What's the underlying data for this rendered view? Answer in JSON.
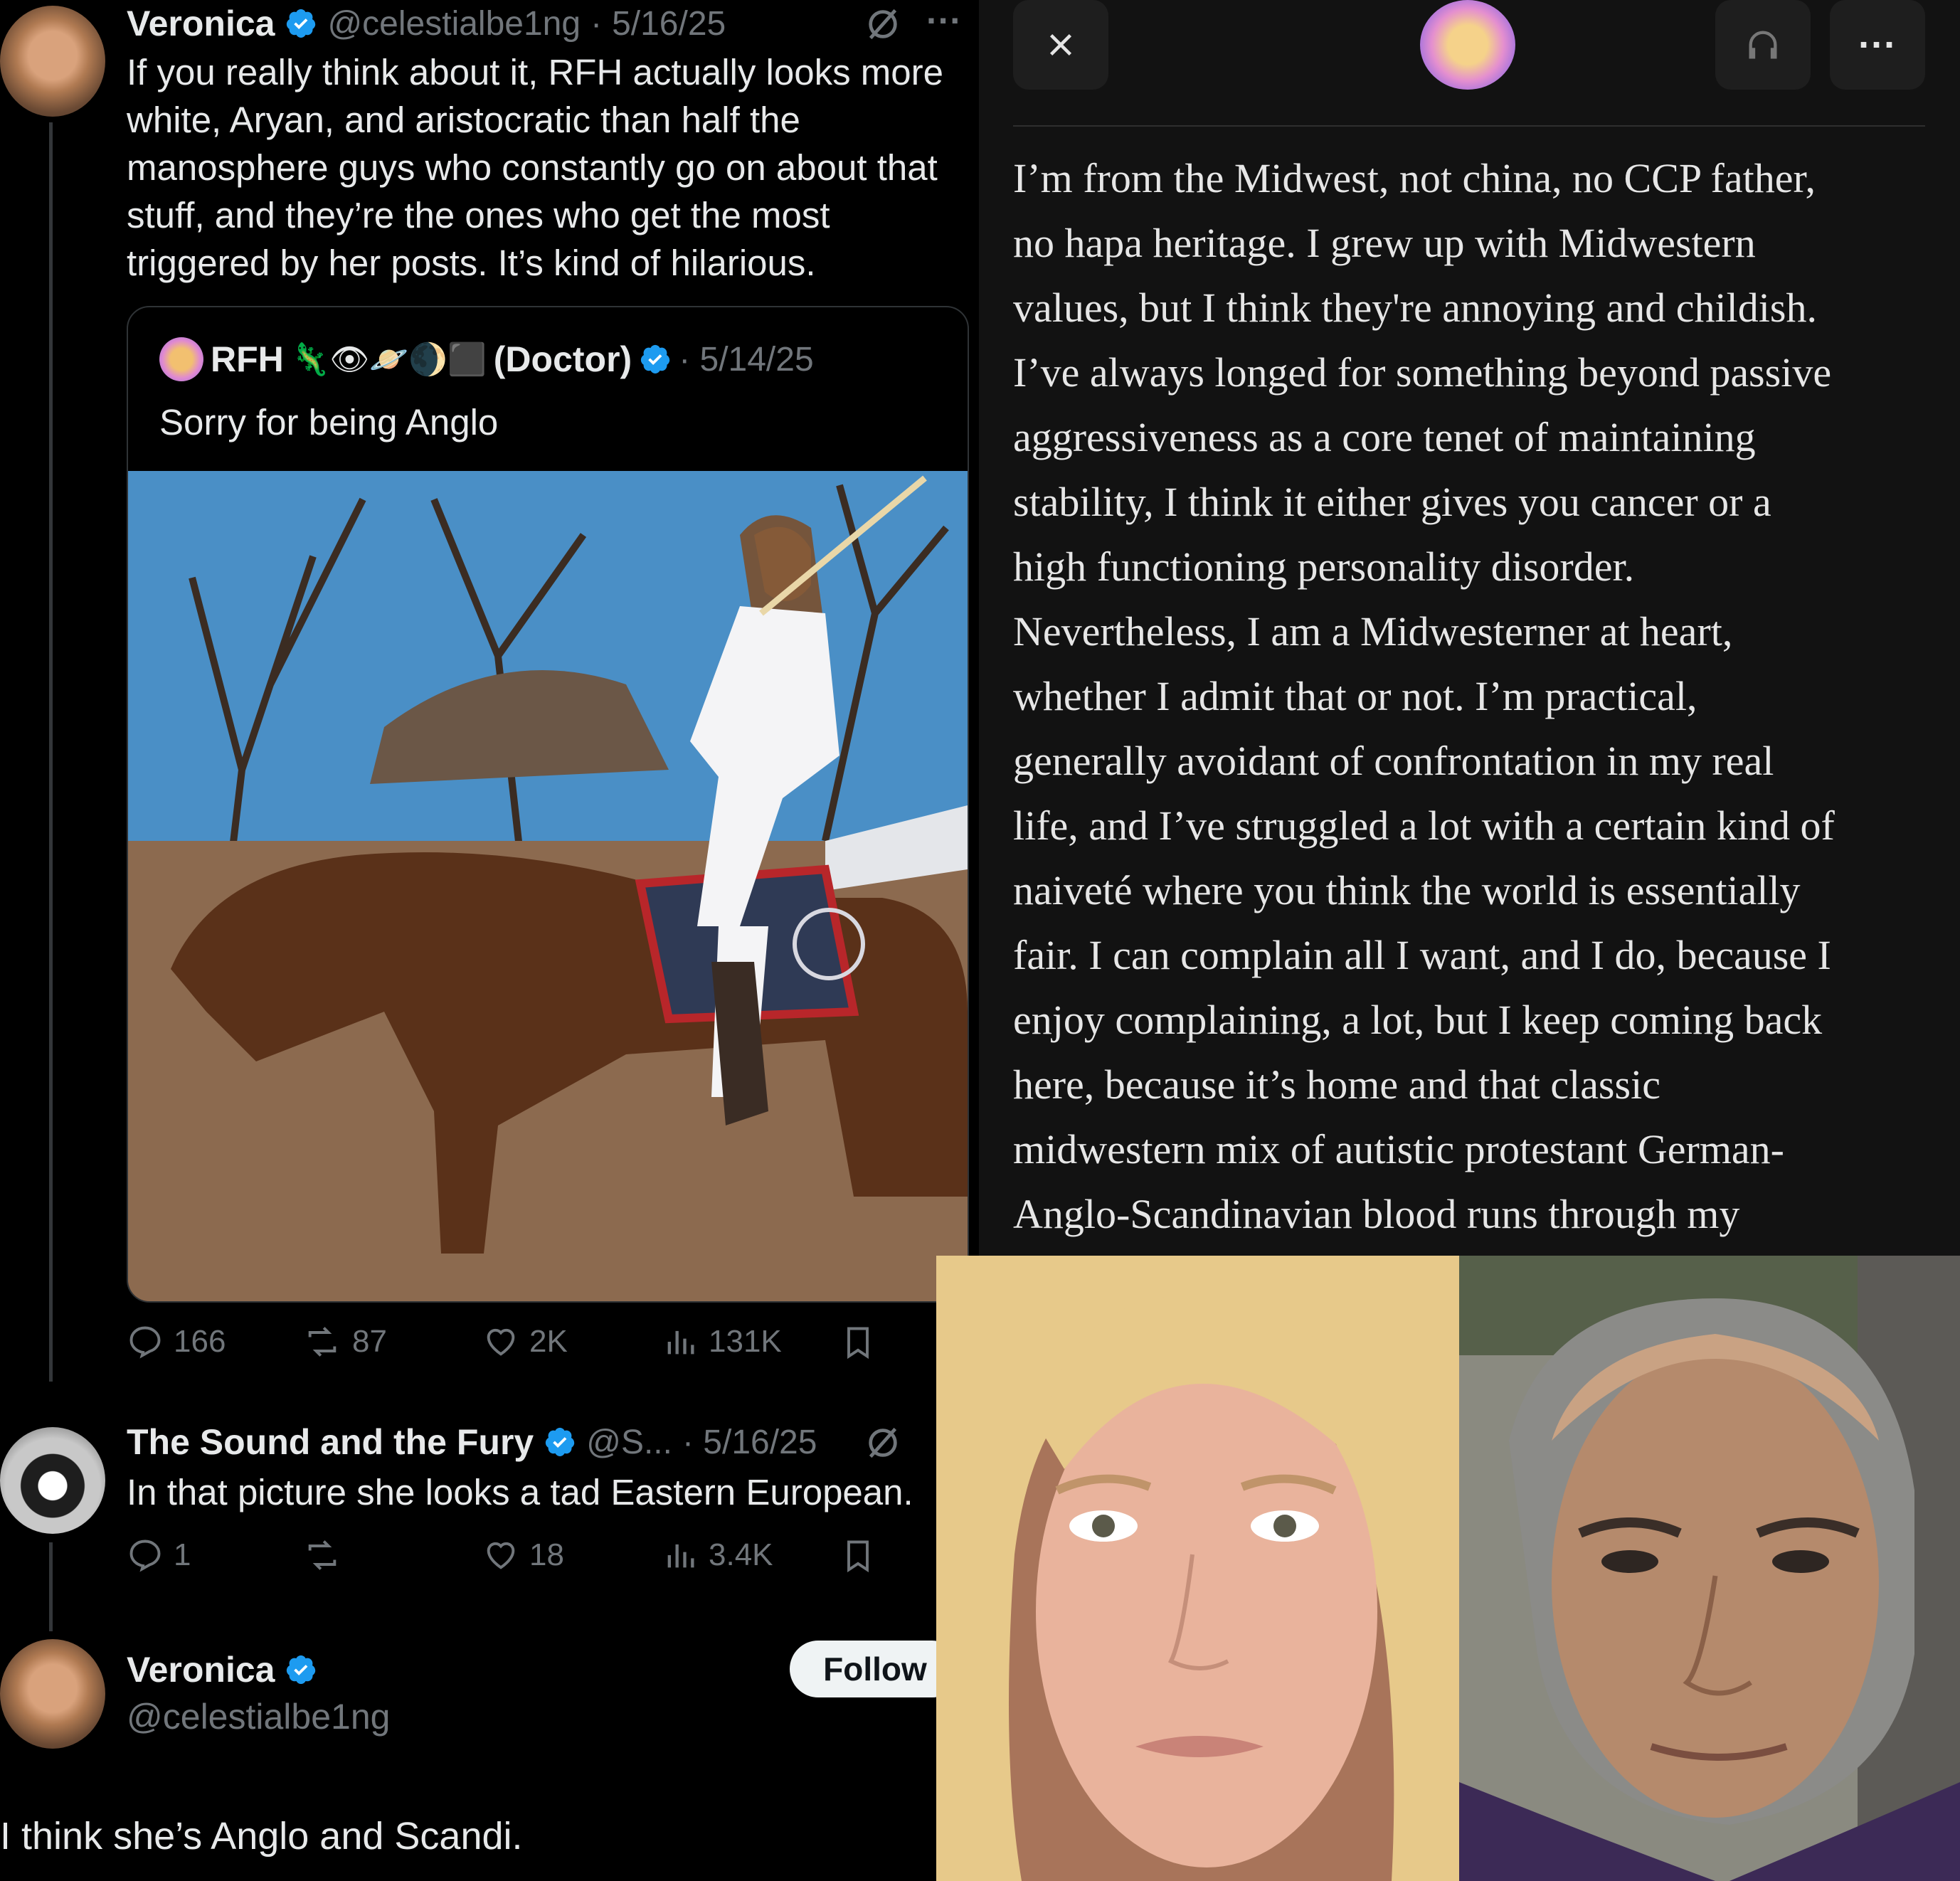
{
  "thread": {
    "tweet1": {
      "name": "Veronica",
      "handle": "@celestialbe1ng",
      "sep": "·",
      "date": "5/16/25",
      "text": "If you really think about it, RFH actually looks more white, Aryan, and aristocratic than half the manosphere guys who constantly go on about that stuff, and they’re the ones who get the most triggered by her posts. It’s kind of hilarious.",
      "quote": {
        "name": "RFH",
        "emojis": "🦎👁🪐🌒⬛",
        "suffix": "(Doctor)",
        "date": "· 5/14/25",
        "text": "Sorry for being Anglo"
      },
      "stats": {
        "replies": "166",
        "reposts": "87",
        "likes": "2K",
        "views": "131K"
      }
    },
    "tweet2": {
      "name": "The Sound and the Fury",
      "handle": "@S...",
      "date": "· 5/16/25",
      "text": "In that picture she looks a tad Eastern European.",
      "stats": {
        "replies": "1",
        "reposts": "",
        "likes": "18",
        "views": "3.4K"
      }
    },
    "tweet3": {
      "name": "Veronica",
      "handle": "@celestialbe1ng",
      "follow_label": "Follow",
      "text": "I think she’s Anglo and Scandi."
    }
  },
  "reader": {
    "close_icon": "close-icon",
    "more_label": "···",
    "lines": [
      "I’m from the Midwest, not china, no CCP father,",
      "no hapa heritage. I grew up with Midwestern",
      "values, but I think they're annoying and childish.",
      "I’ve always longed for something beyond passive",
      "aggressiveness as a core tenet of maintaining",
      "stability, I think it either gives you cancer or a",
      "high functioning personality disorder.",
      "Nevertheless, I am a Midwesterner at heart,",
      "whether I admit that or not. I’m practical,",
      "generally avoidant of confrontation in my real",
      "life, and I’ve struggled a lot with a certain kind of",
      "naiveté where you think the world is essentially",
      "fair. I can complain all I want, and I do, because I",
      "enjoy complaining, a lot, but I keep coming back",
      "here, because it’s home and that classic",
      "midwestern mix of autistic protestant German-",
      "Anglo-Scandinavian blood runs through my"
    ]
  },
  "colors": {
    "verified": "#1d9bf0",
    "muted": "#71767b",
    "text": "#e7e9ea",
    "reader_bg": "#121212"
  }
}
